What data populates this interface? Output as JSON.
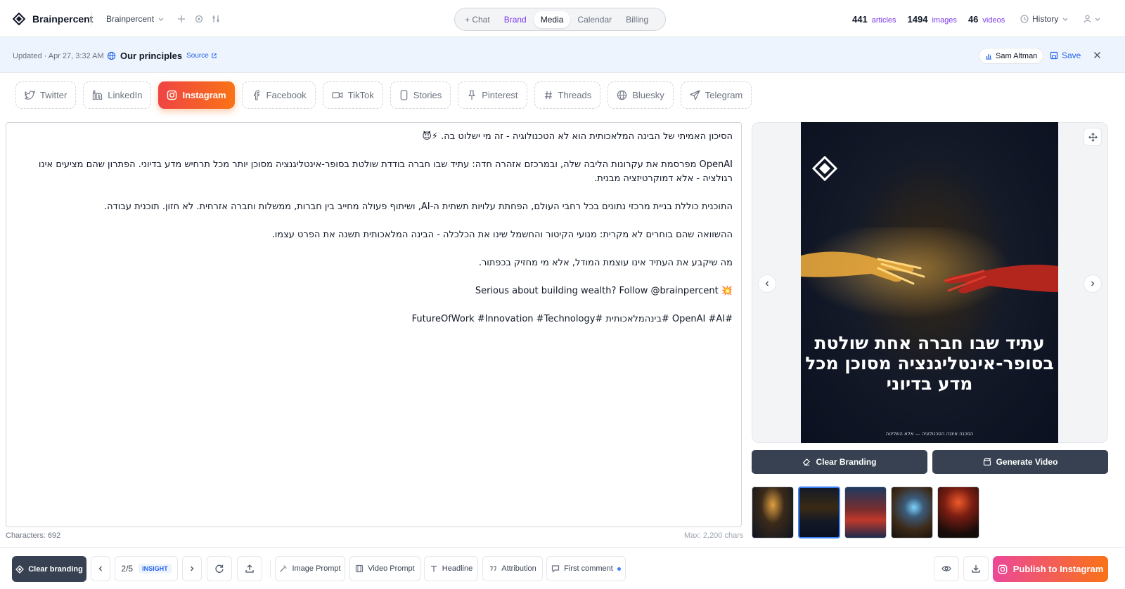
{
  "header": {
    "app_name": "Brainpercent",
    "workspace": "Brainpercent",
    "nav": [
      {
        "label": "+ Chat"
      },
      {
        "label": "Brand"
      },
      {
        "label": "Media"
      },
      {
        "label": "Calendar"
      },
      {
        "label": "Billing"
      }
    ],
    "active_nav": "Media",
    "stats": [
      {
        "count": "441",
        "label": "articles"
      },
      {
        "count": "1494",
        "label": "images"
      },
      {
        "count": "46",
        "label": "videos"
      }
    ],
    "history_label": "History"
  },
  "banner": {
    "updated": "Updated · Apr 27, 3:32 AM",
    "title": "Our principles",
    "source_label": "Source",
    "author": "Sam Altman",
    "save_label": "Save"
  },
  "platform_tabs": [
    {
      "label": "Twitter",
      "icon": "twitter-icon"
    },
    {
      "label": "LinkedIn",
      "icon": "linkedin-icon"
    },
    {
      "label": "Instagram",
      "icon": "instagram-icon"
    },
    {
      "label": "Facebook",
      "icon": "facebook-icon"
    },
    {
      "label": "TikTok",
      "icon": "video-icon"
    },
    {
      "label": "Stories",
      "icon": "phone-icon"
    },
    {
      "label": "Pinterest",
      "icon": "pin-icon"
    },
    {
      "label": "Threads",
      "icon": "hash-icon"
    },
    {
      "label": "Bluesky",
      "icon": "globe-icon"
    },
    {
      "label": "Telegram",
      "icon": "send-icon"
    }
  ],
  "active_platform": "Instagram",
  "editor": {
    "paragraphs": [
      "הסיכון האמיתי של הבינה המלאכותית הוא לא הטכנולוגיה - זה מי ישלוט בה. ⚡😈",
      "OpenAI מפרסמת את עקרונות הליבה שלה, ובמרכזם אזהרה חדה: עתיד שבו חברה בודדת שולטת בסופר-אינטליגנציה מסוכן יותר מכל תרחיש מדע בדיוני. הפתרון שהם מציעים אינו רגולציה - אלא דמוקרטיזציה מבנית.",
      "התוכנית כוללת בניית מרכזי נתונים בכל רחבי העולם, הפחתת עלויות תשתית ה-AI, ושיתוף פעולה מחייב בין חברות, ממשלות וחברה אזרחית. לא חזון. תוכנית עבודה.",
      "ההשוואה שהם בוחרים לא מקרית: מנועי הקיטור והחשמל שינו את הכלכלה - הבינה המלאכותית תשנה את הפרט עצמו.",
      "מה שיקבע את העתיד אינו עוצמת המודל, אלא מי מחזיק בכפתור.",
      "💥 Serious about building wealth? Follow @brainpercent",
      "#OpenAI #AI #בינהמלאכותית #FutureOfWork #Innovation #Technology"
    ],
    "char_count": "Characters: 692",
    "max_chars": "Max: 2,200 chars"
  },
  "preview": {
    "headline": "עתיד שבו חברה אחת שולטת בסופר-אינטליגנציה מסוכן מכל מדע בדיוני",
    "footer": "הסכנה איננה הטכנולוגיה — אלא השליטה",
    "clear_branding_label": "Clear Branding",
    "generate_video_label": "Generate Video",
    "thumbnails_count": 5,
    "selected_thumbnail": 2
  },
  "toolbar": {
    "clear_branding_label": "Clear branding",
    "page": "2/5",
    "page_tag": "INSIGHT",
    "image_prompt": "Image Prompt",
    "video_prompt": "Video Prompt",
    "headline": "Headline",
    "attribution": "Attribution",
    "first_comment": "First comment",
    "publish_label": "Publish to Instagram"
  },
  "colors": {
    "accent": "#7c3aed",
    "link": "#2563eb",
    "instagram_gradient_start": "#ef4444",
    "instagram_gradient_end": "#f97316",
    "dark_button": "#374151"
  }
}
